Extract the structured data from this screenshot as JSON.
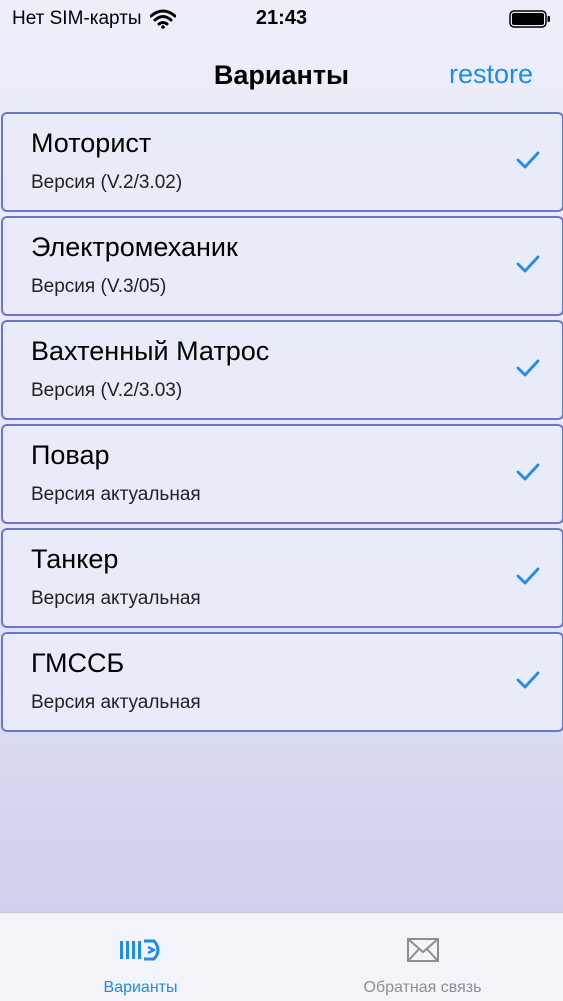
{
  "status_bar": {
    "carrier": "Нет SIM-карты",
    "time": "21:43"
  },
  "nav": {
    "title": "Варианты",
    "restore_label": "restore"
  },
  "items": [
    {
      "title": "Моторист",
      "subtitle": "Версия (V.2/3.02)",
      "checked": true
    },
    {
      "title": "Электромеханик",
      "subtitle": "Версия (V.3/05)",
      "checked": true
    },
    {
      "title": "Вахтенный Матрос",
      "subtitle": "Версия (V.2/3.03)",
      "checked": true
    },
    {
      "title": "Повар",
      "subtitle": "Версия актуальная",
      "checked": true
    },
    {
      "title": "Танкер",
      "subtitle": "Версия актуальная",
      "checked": true
    },
    {
      "title": "ГМССБ",
      "subtitle": "Версия актуальная",
      "checked": true
    }
  ],
  "tab_bar": {
    "variants_label": "Варианты",
    "feedback_label": "Обратная связь"
  },
  "colors": {
    "accent": "#1f8ce6",
    "row_border": "#6e76c9",
    "inactive_tab": "#8d8d95"
  },
  "icons": {
    "wifi": "wifi-icon",
    "battery": "battery-icon",
    "check": "checkmark-icon",
    "variants_tab": "list-arrow-icon",
    "feedback_tab": "envelope-icon"
  }
}
